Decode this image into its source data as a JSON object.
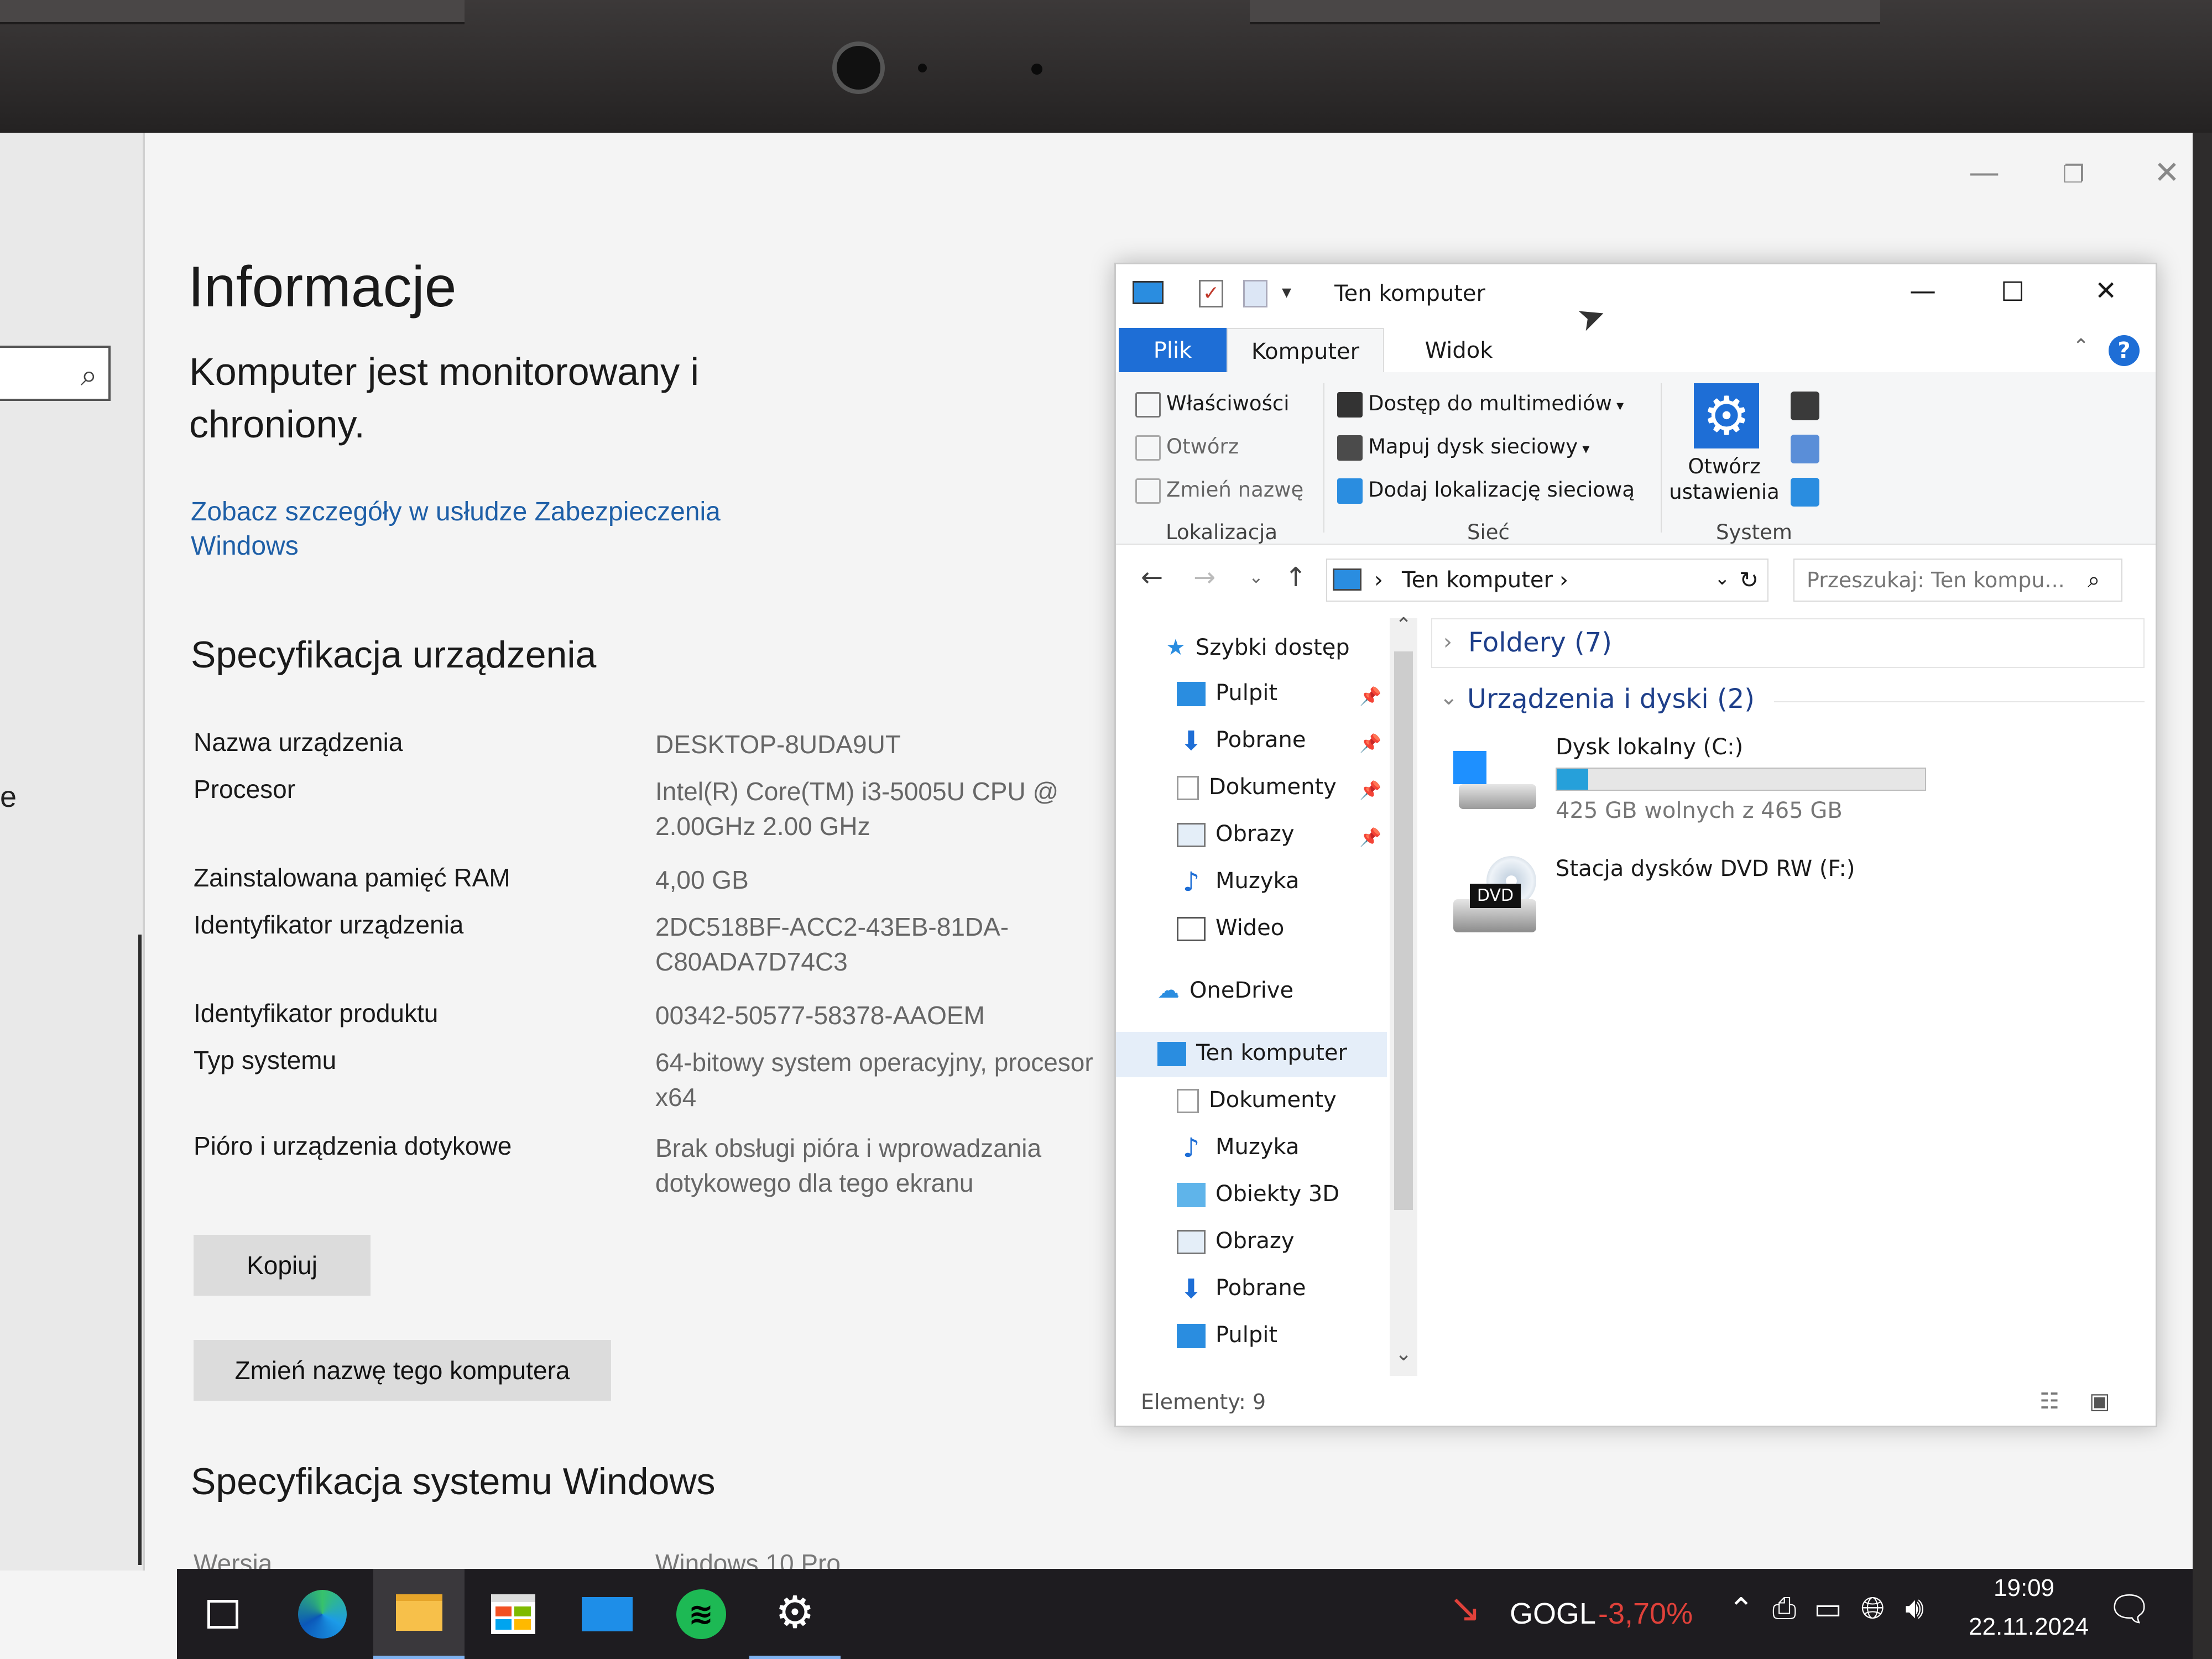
{
  "settings": {
    "title": "Informacje",
    "protection_status": "Komputer jest monitorowany i chroniony.",
    "security_link": "Zobacz szczegóły w usłudze Zabezpieczenia Windows",
    "device_spec_heading": "Specyfikacja urządzenia",
    "specs": [
      {
        "label": "Nazwa urządzenia",
        "value": "DESKTOP-8UDA9UT"
      },
      {
        "label": "Procesor",
        "value": "Intel(R) Core(TM) i3-5005U CPU @ 2.00GHz   2.00 GHz"
      },
      {
        "label": "Zainstalowana pamięć RAM",
        "value": "4,00 GB"
      },
      {
        "label": "Identyfikator urządzenia",
        "value": "2DC518BF-ACC2-43EB-81DA-C80ADA7D74C3"
      },
      {
        "label": "Identyfikator produktu",
        "value": "00342-50577-58378-AAOEM"
      },
      {
        "label": "Typ systemu",
        "value": "64-bitowy system operacyjny, procesor x64"
      },
      {
        "label": "Pióro i urządzenia dotykowe",
        "value": "Brak obsługi pióra i wprowadzania dotykowego dla tego ekranu"
      }
    ],
    "copy_button": "Kopiuj",
    "rename_button": "Zmień nazwę tego komputera",
    "windows_spec_heading": "Specyfikacja systemu Windows",
    "partial_label": "Wersja",
    "partial_value": "Windows 10 Pro",
    "nav_side_text": "e"
  },
  "explorer": {
    "title": "Ten komputer",
    "tabs": [
      "Plik",
      "Komputer",
      "Widok"
    ],
    "ribbon": {
      "location": {
        "items": [
          "Właściwości",
          "Otwórz",
          "Zmień nazwę"
        ],
        "label": "Lokalizacja"
      },
      "network": {
        "items": [
          "Dostęp do multimediów",
          "Mapuj dysk sieciowy",
          "Dodaj lokalizację sieciową"
        ],
        "label": "Sieć"
      },
      "system": {
        "open_settings": "Otwórz ustawienia",
        "label": "System"
      }
    },
    "address": "Ten komputer",
    "search_placeholder": "Przeszukaj: Ten kompu...",
    "nav": {
      "quick_access": "Szybki dostęp",
      "quick_items": [
        "Pulpit",
        "Pobrane",
        "Dokumenty",
        "Obrazy",
        "Muzyka",
        "Wideo"
      ],
      "onedrive": "OneDrive",
      "this_pc": "Ten komputer",
      "pc_items": [
        "Dokumenty",
        "Muzyka",
        "Obiekty 3D",
        "Obrazy",
        "Pobrane",
        "Pulpit"
      ]
    },
    "groups": {
      "folders": "Foldery (7)",
      "devices": "Urządzenia i dyski (2)"
    },
    "drives": {
      "c_name": "Dysk lokalny (C:)",
      "c_free": "425 GB wolnych z 465 GB",
      "c_used_fraction": 0.086,
      "dvd_name": "Stacja dysków DVD RW (F:)",
      "dvd_badge": "DVD"
    },
    "status": "Elementy: 9"
  },
  "taskbar": {
    "stock_name": "GOGL",
    "stock_change": "-3,70%",
    "time": "19:09",
    "date": "22.11.2024"
  },
  "colors": {
    "accent": "#1e6ed6",
    "link": "#1e5fa7",
    "stock_negative": "#e0413a",
    "drive_bar": "#26a0da"
  }
}
